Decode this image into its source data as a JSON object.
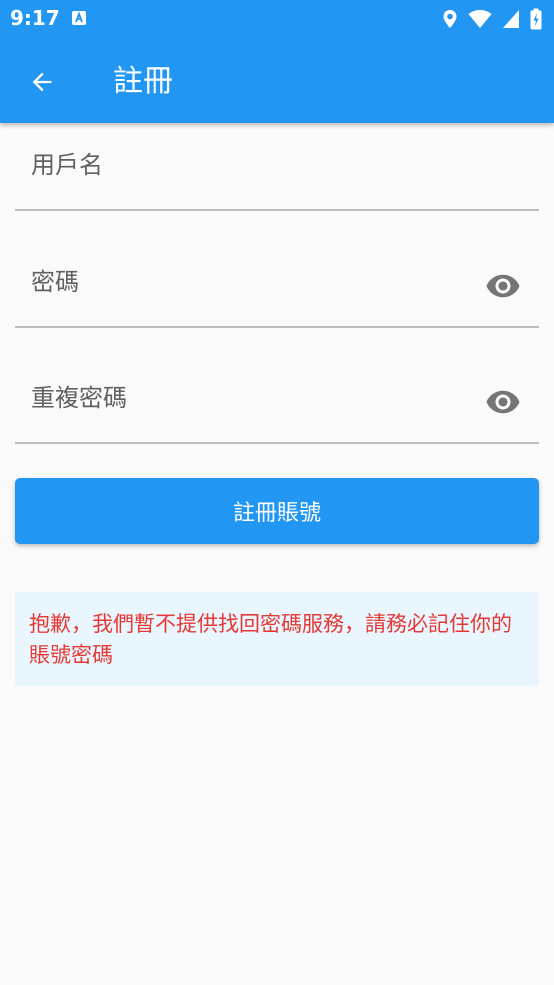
{
  "status_bar": {
    "time": "9:17",
    "icons": [
      "a-notification-icon",
      "location-icon",
      "wifi-icon",
      "signal-icon",
      "battery-charging-icon"
    ]
  },
  "app_bar": {
    "title": "註冊",
    "back_icon": "arrow-left-icon",
    "color": "#2196f3"
  },
  "form": {
    "username": {
      "placeholder": "用戶名",
      "value": ""
    },
    "password": {
      "placeholder": "密碼",
      "value": "",
      "toggle_icon": "eye-icon"
    },
    "confirm_password": {
      "placeholder": "重複密碼",
      "value": "",
      "toggle_icon": "eye-icon"
    },
    "submit_label": "註冊賬號"
  },
  "notice": {
    "text": "抱歉，我們暫不提供找回密碼服務，請務必記住你的賬號密碼",
    "color": "#e53935"
  }
}
